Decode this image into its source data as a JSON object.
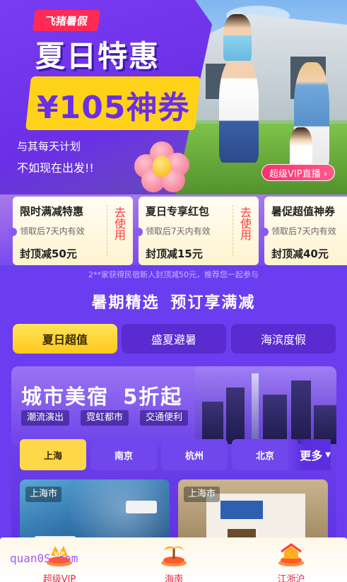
{
  "hero": {
    "brand": "飞猪暑假",
    "title": "夏日特惠",
    "amount": "¥105神券",
    "subtitle1": "与其每天计划",
    "subtitle2": "不如现在出发!!",
    "vip_live": "超级VIP直播 ›"
  },
  "coupons": [
    {
      "title": "限时满减特惠",
      "desc": "领取后7天内有效",
      "amount": "封顶减50元",
      "button": "去使用"
    },
    {
      "title": "夏日专享红包",
      "desc": "领取后7天内有效",
      "amount": "封顶减15元",
      "button": "去使用"
    },
    {
      "title": "暑促超值神券",
      "desc": "领取后7天内有效",
      "amount": "封顶减40元",
      "button": ""
    }
  ],
  "promo_note": "2**家获得民宿新人封顶减50元，推荐您一起参与",
  "section_title": "暑期精选  预订享满减",
  "main_tabs": [
    "夏日超值",
    "盛夏避暑",
    "海滨度假"
  ],
  "city_card": {
    "title": "城市美宿  5折起",
    "features": [
      "潮流演出",
      "霓虹都市",
      "交通便利"
    ],
    "city_tabs": [
      "上海",
      "南京",
      "杭州",
      "北京"
    ],
    "more": "更多",
    "hotels": [
      {
        "city": "上海市"
      },
      {
        "city": "上海市"
      }
    ]
  },
  "bottom_nav": [
    {
      "label": "超级VIP",
      "icon": "vip-icon"
    },
    {
      "label": "海南",
      "icon": "hainan-icon"
    },
    {
      "label": "江浙沪",
      "icon": "jiangzhehu-icon"
    }
  ],
  "watermark": "quan0S.com",
  "colors": {
    "purple": "#6b3df0",
    "yellow": "#ffd21a",
    "red": "#ff2a55"
  }
}
